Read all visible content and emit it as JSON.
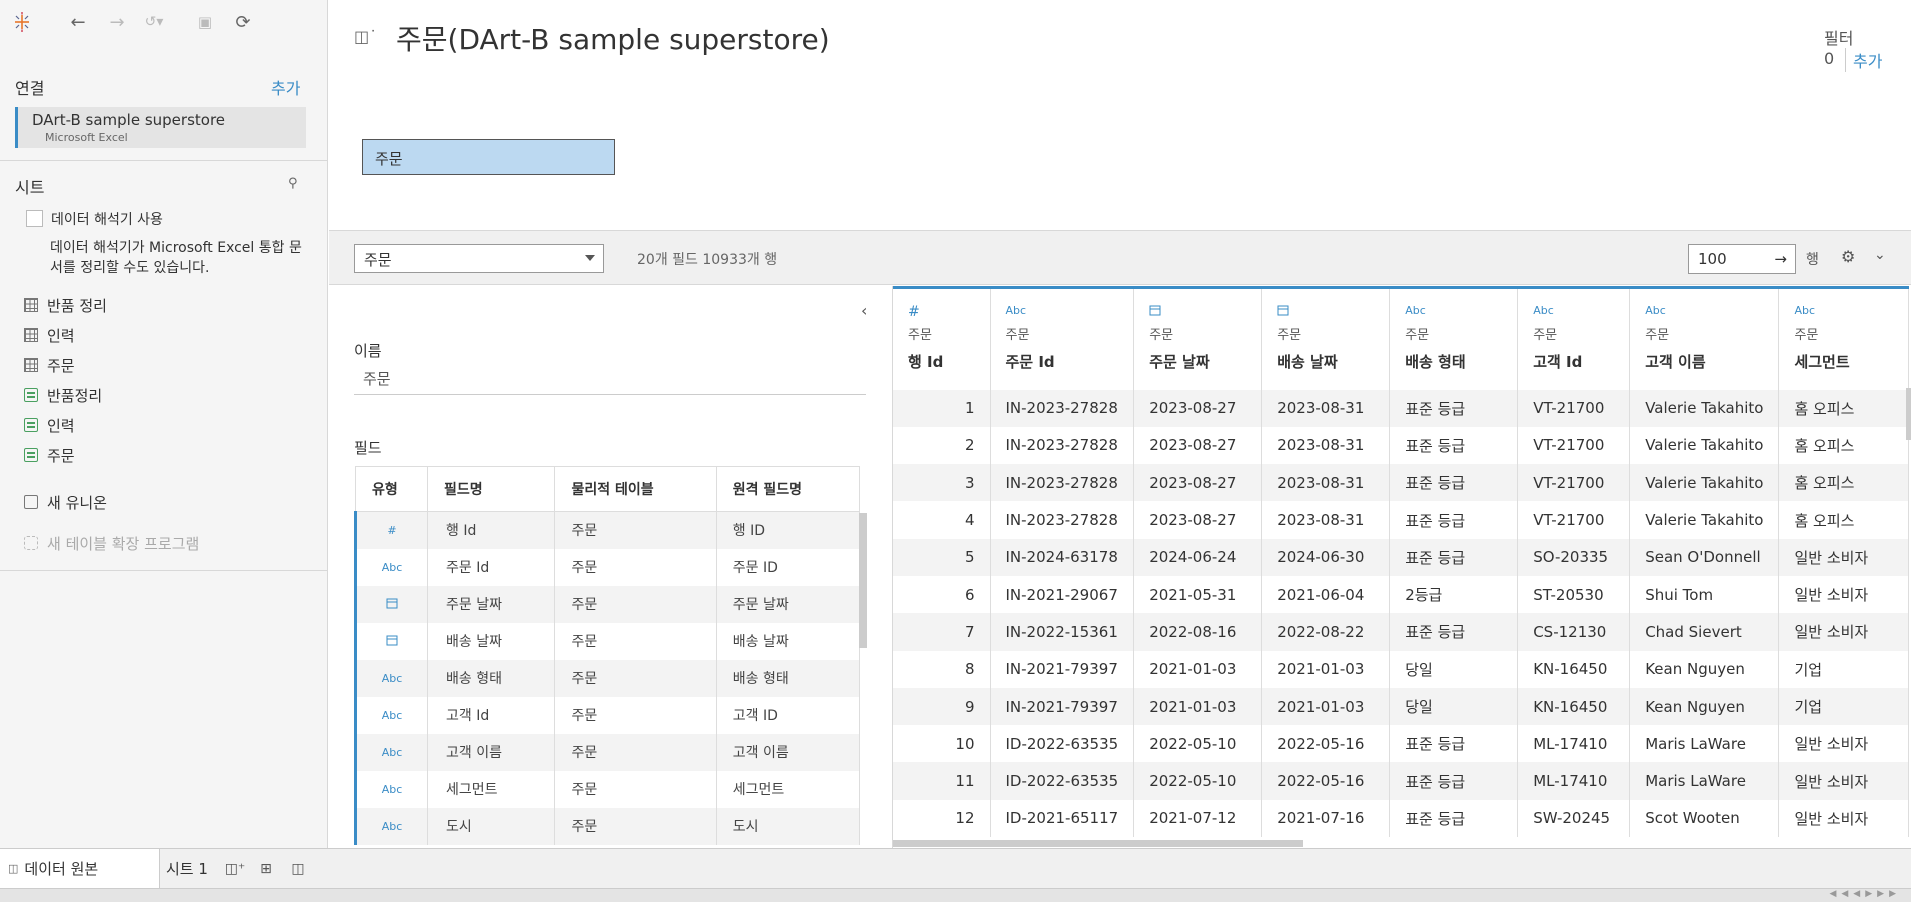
{
  "toolbar": {
    "back_icon": "back-arrow-icon",
    "forward_icon": "forward-arrow-icon",
    "redo_icon": "redo-icon",
    "save_icon": "save-icon",
    "refresh_icon": "refresh-icon"
  },
  "connections": {
    "title": "연결",
    "add_label": "추가",
    "items": [
      {
        "name": "DArt-B sample superstore",
        "type": "Microsoft Excel"
      }
    ]
  },
  "sheets": {
    "title": "시트",
    "interpreter_label": "데이터 해석기 사용",
    "interpreter_desc": "데이터 해석기가 Microsoft Excel 통합 문서를 정리할 수도 있습니다.",
    "items": [
      {
        "label": "반품 정리",
        "kind": "sheet"
      },
      {
        "label": "인력",
        "kind": "sheet"
      },
      {
        "label": "주문",
        "kind": "sheet"
      },
      {
        "label": "반품정리",
        "kind": "named-range"
      },
      {
        "label": "인력",
        "kind": "named-range"
      },
      {
        "label": "주문",
        "kind": "named-range"
      }
    ],
    "new_union": "새 유니온",
    "new_extension": "새 테이블 확장 프로그램"
  },
  "canvas": {
    "title": "주문(DArt-B sample superstore)",
    "filters_label": "필터",
    "filters_count": "0",
    "filters_add": "추가",
    "table_pill": "주문"
  },
  "gridbar": {
    "table_select": "주문",
    "field_count": "20개 필드 10933개 행",
    "rows_value": "100",
    "rows_label": "행"
  },
  "metadata": {
    "name_label": "이름",
    "name_value": "주문",
    "fields_label": "필드",
    "columns": [
      "유형",
      "필드명",
      "물리적 테이블",
      "원격 필드명"
    ],
    "rows": [
      {
        "type": "#",
        "name": "행 Id",
        "table": "주문",
        "remote": "행 ID"
      },
      {
        "type": "Abc",
        "name": "주문 Id",
        "table": "주문",
        "remote": "주문 ID"
      },
      {
        "type": "date",
        "name": "주문 날짜",
        "table": "주문",
        "remote": "주문 날짜"
      },
      {
        "type": "date",
        "name": "배송 날짜",
        "table": "주문",
        "remote": "배송 날짜"
      },
      {
        "type": "Abc",
        "name": "배송 형태",
        "table": "주문",
        "remote": "배송 형태"
      },
      {
        "type": "Abc",
        "name": "고객 Id",
        "table": "주문",
        "remote": "고객 ID"
      },
      {
        "type": "Abc",
        "name": "고객 이름",
        "table": "주문",
        "remote": "고객 이름"
      },
      {
        "type": "Abc",
        "name": "세그먼트",
        "table": "주문",
        "remote": "세그먼트"
      },
      {
        "type": "Abc",
        "name": "도시",
        "table": "주문",
        "remote": "도시"
      }
    ]
  },
  "grid": {
    "columns": [
      {
        "type": "#",
        "table": "주문",
        "name": "행 Id"
      },
      {
        "type": "Abc",
        "table": "주문",
        "name": "주문 Id"
      },
      {
        "type": "date",
        "table": "주문",
        "name": "주문 날짜"
      },
      {
        "type": "date",
        "table": "주문",
        "name": "배송 날짜"
      },
      {
        "type": "Abc",
        "table": "주문",
        "name": "배송 형태"
      },
      {
        "type": "Abc",
        "table": "주문",
        "name": "고객 Id"
      },
      {
        "type": "Abc",
        "table": "주문",
        "name": "고객 이름"
      },
      {
        "type": "Abc",
        "table": "주문",
        "name": "세그먼트"
      }
    ],
    "rows": [
      [
        "1",
        "IN-2023-27828",
        "2023-08-27",
        "2023-08-31",
        "표준 등급",
        "VT-21700",
        "Valerie Takahito",
        "홈 오피스"
      ],
      [
        "2",
        "IN-2023-27828",
        "2023-08-27",
        "2023-08-31",
        "표준 등급",
        "VT-21700",
        "Valerie Takahito",
        "홈 오피스"
      ],
      [
        "3",
        "IN-2023-27828",
        "2023-08-27",
        "2023-08-31",
        "표준 등급",
        "VT-21700",
        "Valerie Takahito",
        "홈 오피스"
      ],
      [
        "4",
        "IN-2023-27828",
        "2023-08-27",
        "2023-08-31",
        "표준 등급",
        "VT-21700",
        "Valerie Takahito",
        "홈 오피스"
      ],
      [
        "5",
        "IN-2024-63178",
        "2024-06-24",
        "2024-06-30",
        "표준 등급",
        "SO-20335",
        "Sean O'Donnell",
        "일반 소비자"
      ],
      [
        "6",
        "IN-2021-29067",
        "2021-05-31",
        "2021-06-04",
        "2등급",
        "ST-20530",
        "Shui Tom",
        "일반 소비자"
      ],
      [
        "7",
        "IN-2022-15361",
        "2022-08-16",
        "2022-08-22",
        "표준 등급",
        "CS-12130",
        "Chad Sievert",
        "일반 소비자"
      ],
      [
        "8",
        "IN-2021-79397",
        "2021-01-03",
        "2021-01-03",
        "당일",
        "KN-16450",
        "Kean Nguyen",
        "기업"
      ],
      [
        "9",
        "IN-2021-79397",
        "2021-01-03",
        "2021-01-03",
        "당일",
        "KN-16450",
        "Kean Nguyen",
        "기업"
      ],
      [
        "10",
        "ID-2022-63535",
        "2022-05-10",
        "2022-05-16",
        "표준 등급",
        "ML-17410",
        "Maris LaWare",
        "일반 소비자"
      ],
      [
        "11",
        "ID-2022-63535",
        "2022-05-10",
        "2022-05-16",
        "표준 등급",
        "ML-17410",
        "Maris LaWare",
        "일반 소비자"
      ],
      [
        "12",
        "ID-2021-65117",
        "2021-07-12",
        "2021-07-16",
        "표준 등급",
        "SW-20245",
        "Scot Wooten",
        "일반 소비자"
      ]
    ]
  },
  "tabs": {
    "datasource": "데이터 원본",
    "sheet": "시트 1"
  }
}
